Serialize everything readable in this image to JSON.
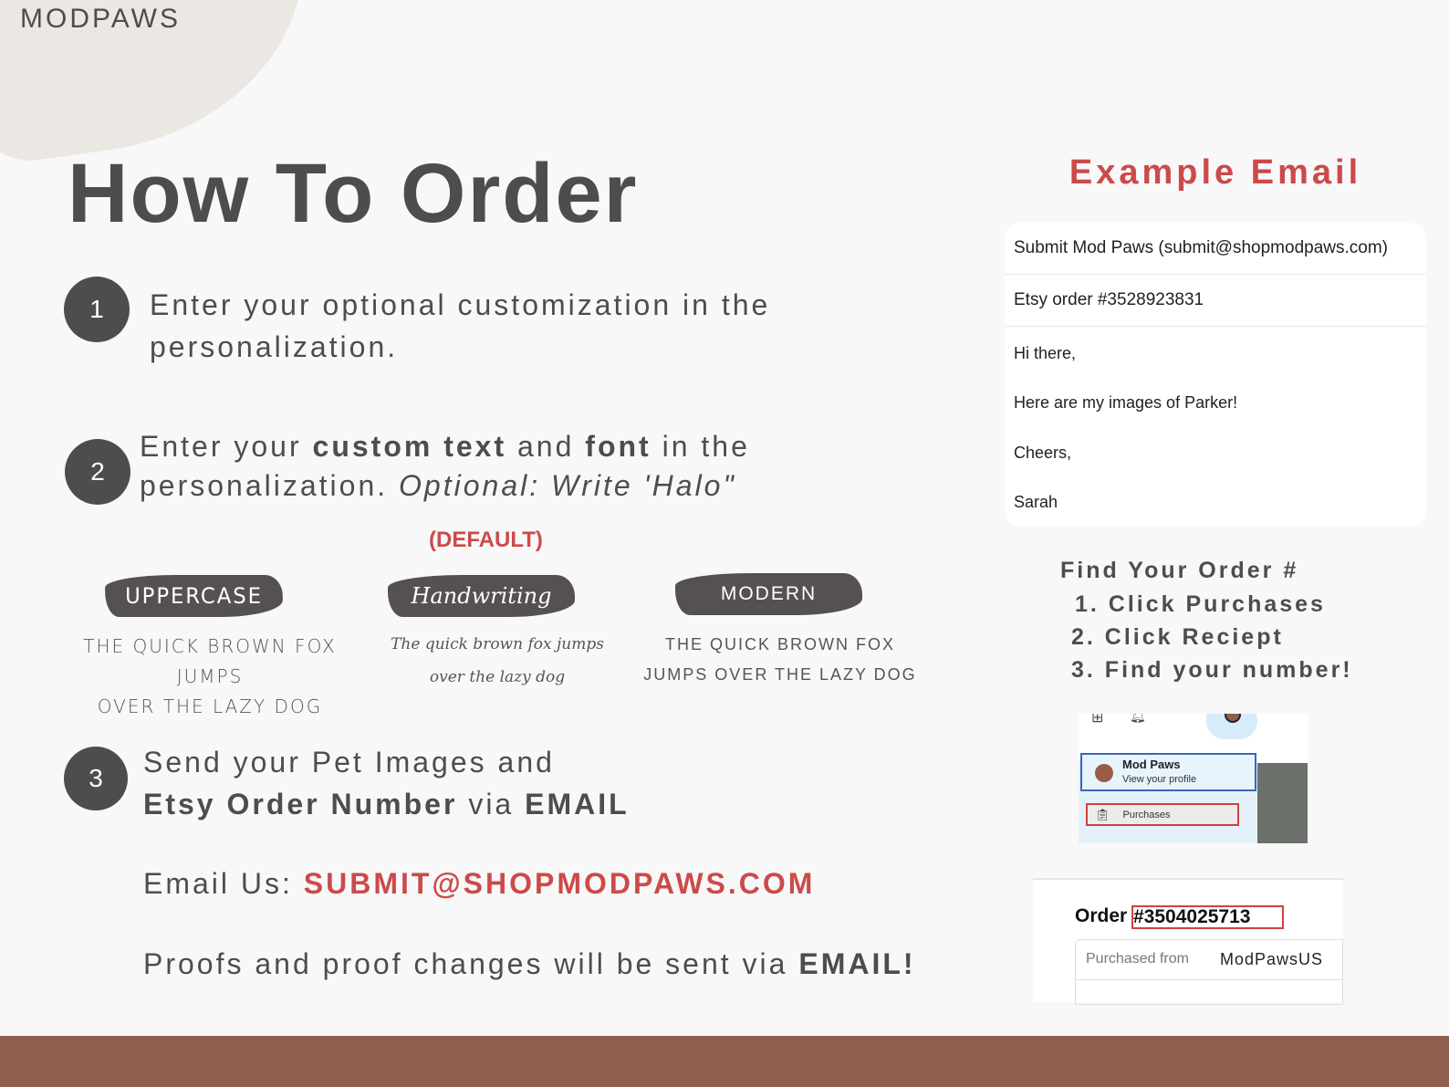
{
  "brand": "MODPAWS",
  "title": "How To Order",
  "steps": [
    {
      "number": "1",
      "line1": "Enter your optional customization in the",
      "line2": "personalization."
    },
    {
      "number": "2",
      "line1_a": "Enter your ",
      "line1_b": "custom text",
      "line1_c": " and ",
      "line1_d": "font",
      "line1_e": " in the",
      "line2_a": "personalization. ",
      "line2_b": "Optional: Write 'Halo\""
    },
    {
      "number": "3",
      "line1": "Send your Pet Images and",
      "line2_a": "Etsy Order Number",
      "line2_b": " via ",
      "line2_c": "EMAIL"
    }
  ],
  "fonts": {
    "default_label": "(DEFAULT)",
    "items": [
      {
        "name": "UPPERCASE",
        "sample1": "THE QUICK BROWN FOX JUMPS",
        "sample2": "OVER THE LAZY DOG"
      },
      {
        "name": "Handwriting",
        "sample1": "The quick brown fox jumps",
        "sample2": "over the lazy dog"
      },
      {
        "name": "MODERN",
        "sample1": "THE QUICK BROWN FOX",
        "sample2": "JUMPS OVER THE LAZY DOG"
      }
    ]
  },
  "email": {
    "label": "Email Us: ",
    "address": "SUBMIT@SHOPMODPAWS.COM"
  },
  "proofs": {
    "text": "Proofs and proof changes will be sent via ",
    "emph": "EMAIL!"
  },
  "example": {
    "title": "Example Email",
    "to": "Submit Mod Paws (submit@shopmodpaws.com)",
    "subject": "Etsy order #3528923831",
    "greeting": "Hi there,",
    "body": "Here are my images of Parker!",
    "closing": "Cheers,",
    "name": "Sarah"
  },
  "find": {
    "title": "Find Your Order #",
    "steps": [
      "1. Click Purchases",
      "2. Click Reciept",
      "3. Find your number!"
    ]
  },
  "screenshot1": {
    "profile_name": "Mod Paws",
    "profile_sub": "View your profile",
    "menu_item": "Purchases"
  },
  "screenshot2": {
    "order_label": "Order",
    "order_number": "#3504025713",
    "purchased_from_label": "Purchased from",
    "shop": "ModPawsUS"
  },
  "colors": {
    "accent": "#cc4a4a",
    "text": "#4f4c4d",
    "footer": "#8e5f4c"
  }
}
